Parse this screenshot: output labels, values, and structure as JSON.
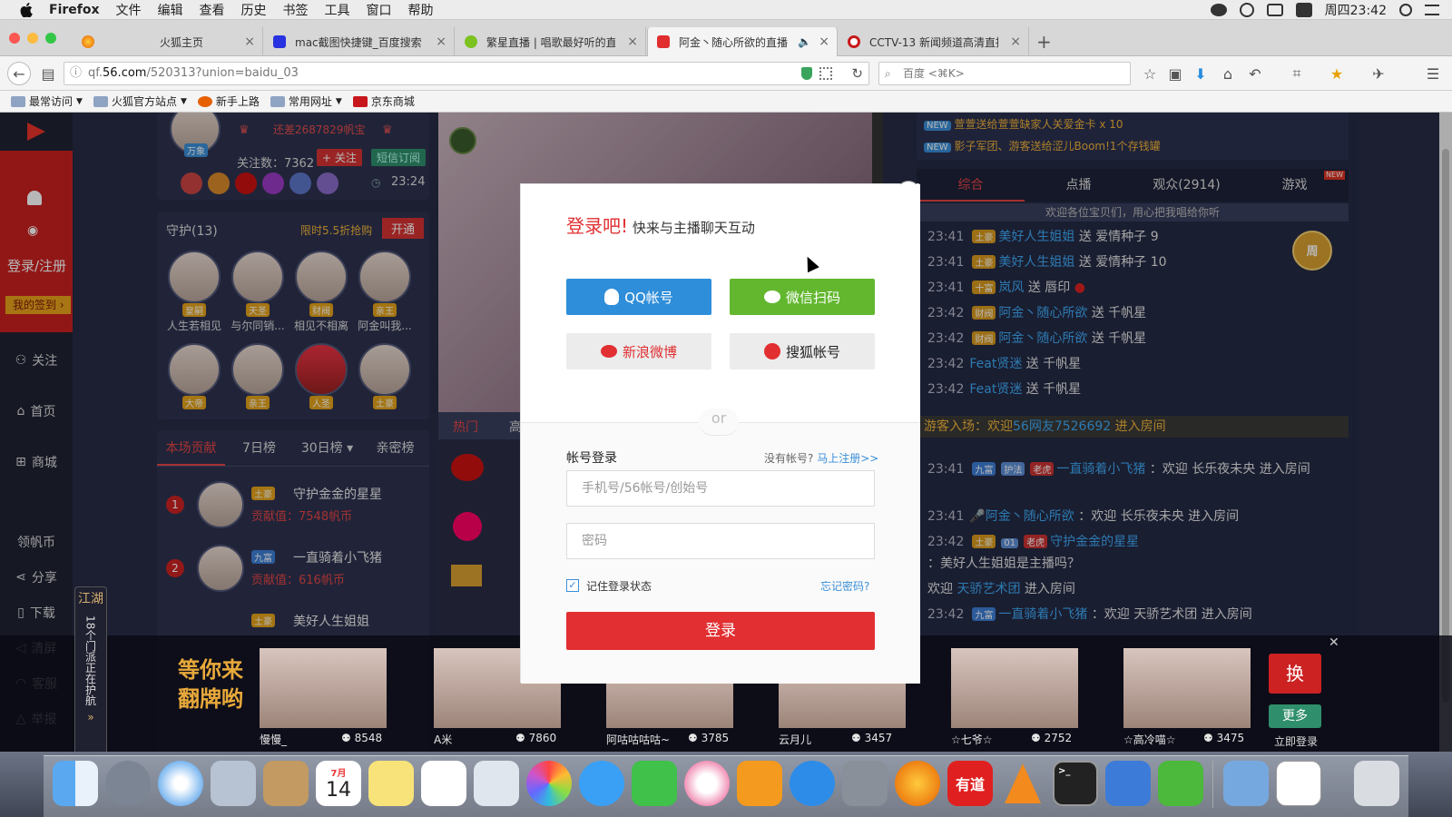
{
  "menubar": {
    "app": "Firefox",
    "menus": [
      "文件",
      "编辑",
      "查看",
      "历史",
      "书签",
      "工具",
      "窗口",
      "帮助"
    ],
    "clock": "周四23:42"
  },
  "tabs": [
    {
      "label": "火狐主页"
    },
    {
      "label": "mac截图快捷键_百度搜索"
    },
    {
      "label": "繁星直播 | 唱歌最好听的直播..."
    },
    {
      "label": "阿金丶随心所欲的直播..."
    },
    {
      "label": "CCTV-13 新闻频道高清直播"
    }
  ],
  "nav": {
    "url_host": "qf.",
    "url_domain": "56.com",
    "url_path": "/520313?union=baidu_03",
    "search_placeholder": "百度 <⌘K>"
  },
  "bookmarks": [
    "最常访问",
    "火狐官方站点",
    "新手上路",
    "常用网址",
    "京东商城"
  ],
  "sidebar": {
    "login": "登录/注册",
    "signin": "我的签到",
    "items": [
      "关注",
      "首页",
      "商城",
      "领帆币",
      "分享",
      "下载",
      "清屏",
      "客服",
      "举报"
    ]
  },
  "anchor": {
    "rank_text": "还差2687829帆宝",
    "level_badge": "万象",
    "followers_label": "关注数：",
    "followers": "7362",
    "follow_btn": "+ 关注",
    "sub_btn": "短信订阅",
    "time": "23:24"
  },
  "guard": {
    "title": "守护(13)",
    "promo": "限时5.5折抢购",
    "open_btn": "开通",
    "members": [
      {
        "name": "人生若相见",
        "badge": "皇嗣"
      },
      {
        "name": "与尔同销...",
        "badge": "天圣"
      },
      {
        "name": "相见不相离",
        "badge": "财阀"
      },
      {
        "name": "阿金叫我...",
        "badge": "亲王"
      },
      {
        "name": "",
        "badge": "大帝"
      },
      {
        "name": "",
        "badge": "亲王"
      },
      {
        "name": "",
        "badge": "人圣"
      },
      {
        "name": "",
        "badge": "土豪"
      }
    ]
  },
  "rank": {
    "tabs": [
      "本场贡献",
      "7日榜",
      "30日榜",
      "亲密榜"
    ],
    "rows": [
      {
        "no": "1",
        "badge": "土豪",
        "name": "守护金金的星星",
        "value": "贡献值：7548帆币"
      },
      {
        "no": "2",
        "badge": "九富",
        "name": "一直骑着小飞猪",
        "value": "贡献值：616帆币"
      },
      {
        "no": "3",
        "badge": "土豪",
        "name": "美好人生姐姐",
        "value": ""
      }
    ]
  },
  "side_strip": {
    "title": "江湖",
    "text": "18个门派正在护航"
  },
  "gifts_tab": {
    "hot": "热门",
    "other": "高"
  },
  "chat": {
    "news": [
      {
        "tag": "NEW",
        "text": "萱萱送给萱萱缺家人关爱金卡 x 10"
      },
      {
        "tag": "NEW",
        "text": "影子军团、游客送给涩儿Boom!1个存钱罐"
      }
    ],
    "tabs": [
      "综合",
      "点播",
      "观众(2914)",
      "游戏"
    ],
    "tab_badge": "NEW",
    "notice": "欢迎各位宝贝们，用心把我唱给你听",
    "week_badge": "周",
    "gifts": [
      {
        "time": "23:41",
        "user": "美好人生姐姐",
        "action": "送",
        "gift": "爱情种子",
        "count": "9"
      },
      {
        "time": "23:41",
        "user": "美好人生姐姐",
        "action": "送",
        "gift": "爱情种子",
        "count": "10"
      },
      {
        "time": "23:41",
        "user": "岚风",
        "action": "送",
        "gift": "唇印",
        "count": ""
      },
      {
        "time": "23:42",
        "user": "阿金丶随心所欲",
        "action": "送",
        "gift": "千帆星",
        "count": ""
      },
      {
        "time": "23:42",
        "user": "阿金丶随心所欲",
        "action": "送",
        "gift": "千帆星",
        "count": ""
      },
      {
        "time": "23:42",
        "user": "Feat贤迷",
        "action": "送",
        "gift": "千帆星",
        "count": ""
      },
      {
        "time": "23:42",
        "user": "Feat贤迷",
        "action": "送",
        "gift": "千帆星",
        "count": ""
      }
    ],
    "guest_bar": {
      "prefix": "游客入场：欢迎",
      "user": "56网友7526692",
      "suffix": "进入房间"
    },
    "messages": [
      {
        "time": "",
        "user": "欢迎",
        "text": "长乐夜未央 进入房间"
      },
      {
        "time": "23:41",
        "user": "一直骑着小飞猪",
        "text": "：欢迎 长乐夜未央 进入房间"
      },
      {
        "time": "23:41",
        "user": "阿金丶随心所欲",
        "text": "：欢迎 长乐夜未央 进入房间"
      },
      {
        "time": "23:42",
        "user": "守护金金的星星",
        "text": "：美好人生姐姐是主播吗？"
      },
      {
        "time": "",
        "user": "天骄艺术团",
        "text": "进入房间"
      },
      {
        "time": "23:42",
        "user": "一直骑着小飞猪",
        "text": "：欢迎 天骄艺术团 进入房间"
      }
    ],
    "level_tags": [
      "土豪",
      "九富",
      "老虎",
      "01",
      "护法",
      "老虎"
    ]
  },
  "bottom": {
    "slogan1": "等你来",
    "slogan2": "翻牌哟",
    "swap_btn": "换",
    "more_btn": "更多",
    "login_now": "立即登录",
    "anchors": [
      {
        "name": "慢慢_",
        "viewers": "8548"
      },
      {
        "name": "A米",
        "viewers": "7860"
      },
      {
        "name": "阿咕咕咕咕~",
        "viewers": "3785"
      },
      {
        "name": "云月儿",
        "viewers": "3457"
      },
      {
        "name": "☆七爷☆",
        "viewers": "2752"
      },
      {
        "name": "☆高冷喵☆",
        "viewers": "3475"
      }
    ]
  },
  "modal": {
    "title_red": "登录吧!",
    "title_rest": "快来与主播聊天互动",
    "qq": "QQ帐号",
    "wechat": "微信扫码",
    "weibo": "新浪微博",
    "sohu": "搜狐帐号",
    "or": "or",
    "account_title": "帐号登录",
    "no_account": "没有帐号?",
    "register": "马上注册>>",
    "username_placeholder": "手机号/56帐号/创始号",
    "password_placeholder": "密码",
    "remember": "记住登录状态",
    "forgot": "忘记密码?",
    "submit": "登录",
    "colors": {
      "qq": "#2f8ed9",
      "wechat": "#62b72f",
      "submit": "#e12f32"
    }
  },
  "dock": {
    "calendar_month": "7月",
    "calendar_day": "14",
    "youdao": "有道"
  }
}
